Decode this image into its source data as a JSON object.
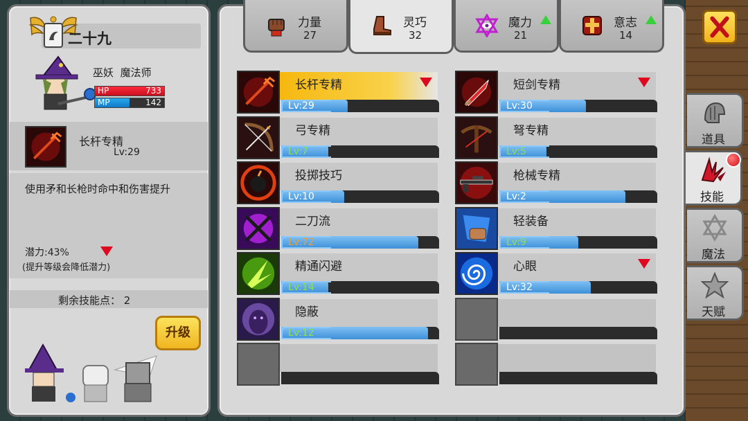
{
  "character": {
    "name": "二十九",
    "race": "巫妖",
    "class": "魔法师",
    "hp_label": "HP",
    "hp": "733",
    "mp_label": "MP",
    "mp": "142",
    "mp_fraction": 0.5
  },
  "selected_skill": {
    "name": "长杆专精",
    "level": "Lv:29",
    "description": "使用矛和长枪时命中和伤害提升",
    "potential": "潜力:43%",
    "potential_note": "(提升等级会降低潜力)"
  },
  "remaining_points": "剩余技能点： 2",
  "upgrade_label": "升级",
  "stat_tabs": [
    {
      "name": "力量",
      "value": "27",
      "icon": "fist-icon",
      "up": false
    },
    {
      "name": "灵巧",
      "value": "32",
      "icon": "boot-icon",
      "up": false
    },
    {
      "name": "魔力",
      "value": "21",
      "icon": "magic-eye-icon",
      "up": true
    },
    {
      "name": "意志",
      "value": "14",
      "icon": "cross-shield-icon",
      "up": true
    }
  ],
  "skills": [
    {
      "name": "长杆专精",
      "level": "Lv:29",
      "fill": 0.42,
      "color": "white",
      "down": true,
      "icon": "trident-icon"
    },
    {
      "name": "短剑专精",
      "level": "Lv:30",
      "fill": 0.55,
      "color": "white",
      "down": true,
      "icon": "short-sword-icon"
    },
    {
      "name": "弓专精",
      "level": "Lv:7",
      "fill": 0.3,
      "color": "green",
      "down": false,
      "icon": "bow-icon"
    },
    {
      "name": "弩专精",
      "level": "Lv:5",
      "fill": 0.3,
      "color": "green",
      "down": false,
      "icon": "crossbow-icon"
    },
    {
      "name": "投掷技巧",
      "level": "Lv:10",
      "fill": 0.4,
      "color": "white",
      "down": false,
      "icon": "bomb-icon"
    },
    {
      "name": "枪械专精",
      "level": "Lv:2",
      "fill": 0.8,
      "color": "white",
      "down": false,
      "icon": "rifle-icon"
    },
    {
      "name": "二刀流",
      "level": "Lv:72",
      "fill": 0.87,
      "color": "orange",
      "down": false,
      "icon": "dual-blades-icon"
    },
    {
      "name": "轻装备",
      "level": "Lv:9",
      "fill": 0.5,
      "color": "green",
      "down": false,
      "icon": "light-armor-icon"
    },
    {
      "name": "精通闪避",
      "level": "Lv:14",
      "fill": 0.3,
      "color": "green",
      "down": false,
      "icon": "dodge-icon"
    },
    {
      "name": "心眼",
      "level": "Lv:32",
      "fill": 0.58,
      "color": "white",
      "down": true,
      "icon": "mind-eye-icon"
    },
    {
      "name": "隐蔽",
      "level": "Lv:12",
      "fill": 0.93,
      "color": "green",
      "down": false,
      "icon": "stealth-icon"
    },
    {
      "name": "",
      "level": "",
      "fill": 0,
      "color": "white",
      "down": false,
      "icon": "",
      "empty": true
    },
    {
      "name": "",
      "level": "",
      "fill": 0,
      "color": "white",
      "down": false,
      "icon": "",
      "empty": true
    },
    {
      "name": "",
      "level": "",
      "fill": 0,
      "color": "white",
      "down": false,
      "icon": "",
      "empty": true
    }
  ],
  "side_tabs": [
    {
      "label": "道具",
      "icon": "helmet-icon"
    },
    {
      "label": "技能",
      "icon": "skill-wings-icon"
    },
    {
      "label": "魔法",
      "icon": "hexagram-icon"
    },
    {
      "label": "天赋",
      "icon": "star-icon"
    }
  ],
  "colors": {
    "accent": "#f5b810",
    "hp": "#e0081e",
    "mp": "#2a8ee0",
    "panel": "#d8d8d8"
  }
}
